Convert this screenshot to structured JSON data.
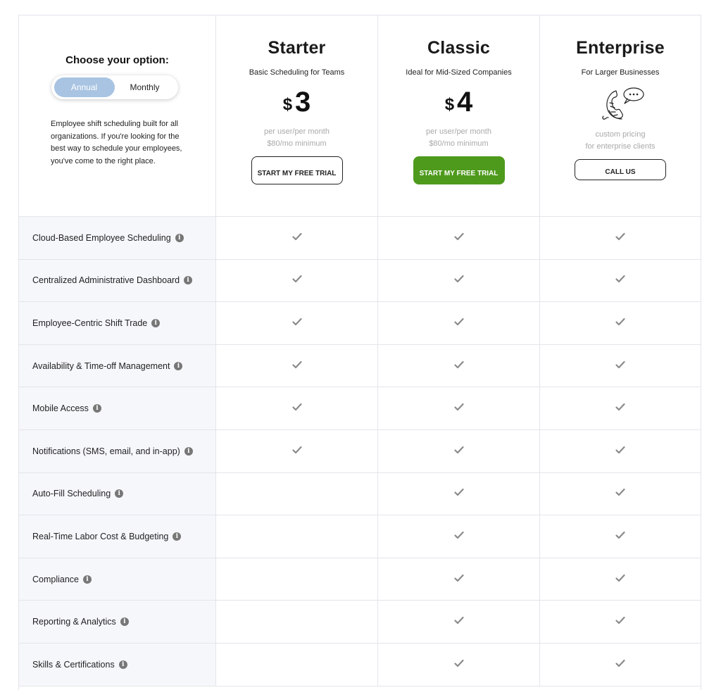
{
  "options": {
    "title": "Choose your option:",
    "toggle": {
      "annual": "Annual",
      "monthly": "Monthly",
      "selected": "Annual"
    },
    "intro": "Employee shift scheduling built for all organizations. If you're looking for the best way to schedule your employees, you've come to the right place."
  },
  "plans": [
    {
      "name": "Starter",
      "subtitle": "Basic Scheduling for Teams",
      "currency": "$",
      "price": "3",
      "note_line1": "per user/per month",
      "note_line2": "$80/mo minimum",
      "button": "START MY FREE TRIAL"
    },
    {
      "name": "Classic",
      "subtitle": "Ideal for Mid-Sized Companies",
      "currency": "$",
      "price": "4",
      "note_line1": "per user/per month",
      "note_line2": "$80/mo minimum",
      "button": "START MY FREE TRIAL"
    },
    {
      "name": "Enterprise",
      "subtitle": "For Larger Businesses",
      "icon": "phone-chat-icon",
      "note_line1": "custom pricing",
      "note_line2": "for enterprise clients",
      "button": "CALL US"
    }
  ],
  "features": [
    {
      "label": "Cloud-Based Employee Scheduling",
      "starter": true,
      "classic": true,
      "enterprise": true
    },
    {
      "label": "Centralized Administrative Dashboard",
      "starter": true,
      "classic": true,
      "enterprise": true
    },
    {
      "label": "Employee-Centric Shift Trade",
      "starter": true,
      "classic": true,
      "enterprise": true
    },
    {
      "label": "Availability & Time-off Management",
      "starter": true,
      "classic": true,
      "enterprise": true
    },
    {
      "label": "Mobile Access",
      "starter": true,
      "classic": true,
      "enterprise": true
    },
    {
      "label": "Notifications (SMS, email, and in-app)",
      "starter": true,
      "classic": true,
      "enterprise": true
    },
    {
      "label": "Auto-Fill Scheduling",
      "starter": false,
      "classic": true,
      "enterprise": true
    },
    {
      "label": "Real-Time Labor Cost & Budgeting",
      "starter": false,
      "classic": true,
      "enterprise": true
    },
    {
      "label": "Compliance",
      "starter": false,
      "classic": true,
      "enterprise": true
    },
    {
      "label": "Reporting & Analytics",
      "starter": false,
      "classic": true,
      "enterprise": true
    },
    {
      "label": "Skills & Certifications",
      "starter": false,
      "classic": true,
      "enterprise": true
    }
  ],
  "colors": {
    "accent_green": "#4e9a1c",
    "toggle_active": "#a9c4e2",
    "row_bg": "#f6f7fb",
    "check": "#8a8a8a"
  }
}
